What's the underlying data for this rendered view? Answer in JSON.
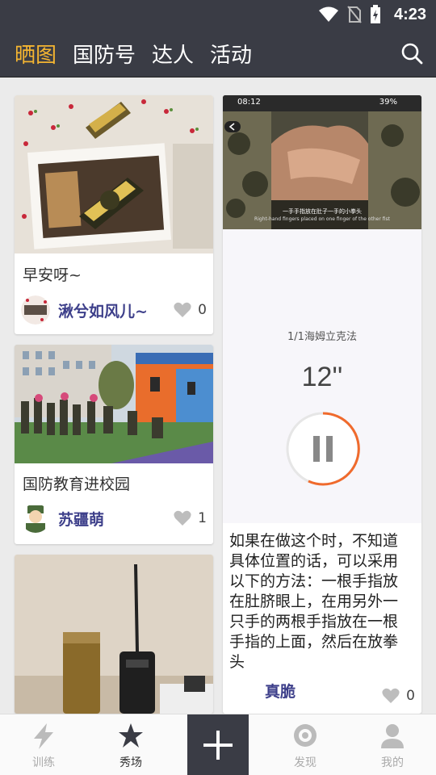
{
  "status_bar": {
    "time": "4:23"
  },
  "header": {
    "tabs": [
      {
        "label": "晒图",
        "active": true
      },
      {
        "label": "国防号",
        "active": false
      },
      {
        "label": "达人",
        "active": false
      },
      {
        "label": "活动",
        "active": false
      }
    ],
    "accent_color": "#f4b531"
  },
  "feed": {
    "left_column": [
      {
        "title": "早安呀~",
        "author": "湫兮如风儿~",
        "likes": "0"
      },
      {
        "title": "国防教育进校园",
        "author": "苏疆萌",
        "likes": "1"
      },
      {
        "title": "",
        "author": "",
        "likes": ""
      }
    ],
    "right_column": [
      {
        "screenshot": {
          "status_time": "08:12",
          "battery": "39%",
          "subtitle_cn": "一手手指放在肚子一手的小拳头",
          "subtitle_en": "Right-hand fingers placed on one finger of the other fist"
        },
        "exercise_label": "1/1海姆立克法",
        "timer": "12''",
        "body": "如果在做这个时，不知道具体位置的话，可以采用以下的方法：一根手指放在肚脐眼上，在用另外一只手的两根手指放在一根手指的上面，然后在放拳头",
        "author": "真脆",
        "likes": "0"
      }
    ]
  },
  "bottom_nav": {
    "items": [
      {
        "label": "训练",
        "icon": "lightning-icon"
      },
      {
        "label": "秀场",
        "icon": "star-icon",
        "active": true
      },
      {
        "label": "",
        "icon": "plus-icon"
      },
      {
        "label": "发现",
        "icon": "compass-icon"
      },
      {
        "label": "我的",
        "icon": "person-icon"
      }
    ]
  }
}
